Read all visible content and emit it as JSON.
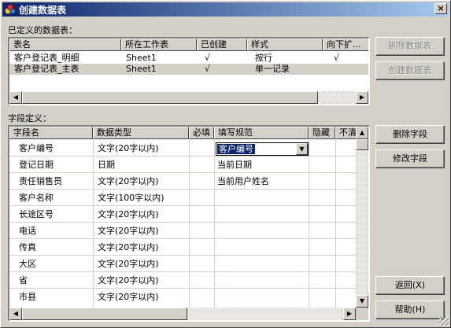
{
  "window": {
    "title": "创建数据表",
    "close_glyph": "×"
  },
  "tables_section": {
    "label": "已定义的数据表：",
    "columns": [
      "表名",
      "所在工作表",
      "已创建",
      "样式",
      "向下扩..."
    ],
    "rows": [
      {
        "name": "客户登记表_明细",
        "sheet": "Sheet1",
        "created": "√",
        "style": "按行",
        "expand": "√"
      },
      {
        "name": "客户登记表_主表",
        "sheet": "Sheet1",
        "created": "√",
        "style": "单一记录",
        "expand": ""
      }
    ]
  },
  "fields_section": {
    "label": "字段定义：",
    "columns": [
      "字段名",
      "数据类型",
      "必填",
      "填写规范",
      "隐藏",
      "不清"
    ],
    "rows": [
      {
        "name": "客户编号",
        "type": "文字(20字以内)",
        "required": "",
        "rule": "客户编号",
        "hidden": ""
      },
      {
        "name": "登记日期",
        "type": "日期",
        "required": "",
        "rule": "当前日期",
        "hidden": ""
      },
      {
        "name": "责任销售员",
        "type": "文字(20字以内)",
        "required": "",
        "rule": "当前用户姓名",
        "hidden": ""
      },
      {
        "name": "客户名称",
        "type": "文字(100字以内)",
        "required": "",
        "rule": "",
        "hidden": ""
      },
      {
        "name": "长途区号",
        "type": "文字(20字以内)",
        "required": "",
        "rule": "",
        "hidden": ""
      },
      {
        "name": "电话",
        "type": "文字(20字以内)",
        "required": "",
        "rule": "",
        "hidden": ""
      },
      {
        "name": "传真",
        "type": "文字(20字以内)",
        "required": "",
        "rule": "",
        "hidden": ""
      },
      {
        "name": "大区",
        "type": "文字(20字以内)",
        "required": "",
        "rule": "",
        "hidden": ""
      },
      {
        "name": "省",
        "type": "文字(20字以内)",
        "required": "",
        "rule": "",
        "hidden": ""
      },
      {
        "name": "市县",
        "type": "文字(20字以内)",
        "required": "",
        "rule": "",
        "hidden": ""
      }
    ]
  },
  "buttons": {
    "delete_table": "删除数据表",
    "create_table": "创建数据表",
    "delete_field": "删除字段",
    "modify_field": "修改字段",
    "back": "返回(X)",
    "help": "帮助(H)"
  },
  "glyphs": {
    "left_arrow": "◀",
    "right_arrow": "▶",
    "up_arrow": "▲",
    "down_arrow": "▼"
  }
}
